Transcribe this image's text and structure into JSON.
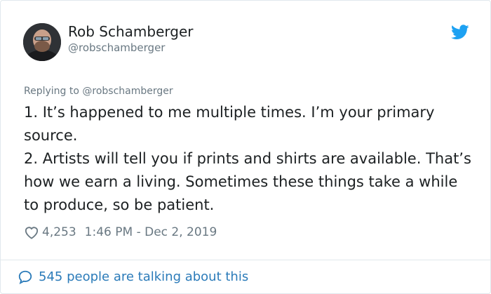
{
  "author": {
    "name": "Rob Schamberger",
    "handle": "@robschamberger"
  },
  "reply_context": "Replying to @robschamberger",
  "tweet": {
    "line1": "1. It’s happened to me multiple times. I’m your primary source.",
    "line2": "2. Artists will tell you if prints and shirts are available. That’s how we earn a living. Sometimes these things take a while to produce, so be patient."
  },
  "meta": {
    "likes": "4,253",
    "time": "1:46 PM - Dec 2, 2019"
  },
  "footer": {
    "talking": "545 people are talking about this"
  },
  "icons": {
    "brand": "twitter-bird-icon",
    "like": "heart-icon",
    "reply": "speech-bubble-icon"
  },
  "colors": {
    "twitter_blue": "#1da1f2",
    "link_blue": "#2b7bb9",
    "muted": "#697882",
    "text": "#1c2022"
  }
}
